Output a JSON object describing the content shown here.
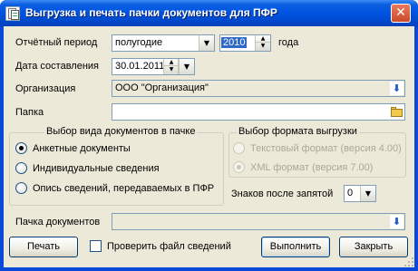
{
  "window": {
    "title": "Выгрузка и печать пачки документов для ПФР",
    "close_glyph": "✕"
  },
  "form": {
    "period_label": "Отчётный период",
    "period_value": "полугодие",
    "year_value": "2010",
    "year_suffix": "года",
    "date_label": "Дата составления",
    "date_value": "30.01.2011",
    "org_label": "Организация",
    "org_value": "ООО \"Организация\"",
    "folder_label": "Папка",
    "folder_value": "",
    "decimals_label": "Знаков после запятой",
    "decimals_value": "0",
    "pack_label": "Пачка документов",
    "pack_value": ""
  },
  "doc_type_group": {
    "title": "Выбор вида документов в пачке",
    "options": [
      {
        "label": "Анкетные документы",
        "selected": true
      },
      {
        "label": "Индивидуальные сведения",
        "selected": false
      },
      {
        "label": "Опись сведений, передаваемых в ПФР",
        "selected": false
      }
    ]
  },
  "format_group": {
    "title": "Выбор формата выгрузки",
    "options": [
      {
        "label": "Текстовый формат (версия 4.00)",
        "selected": false,
        "enabled": false
      },
      {
        "label": "XML формат (версия 7.00)",
        "selected": true,
        "enabled": false
      }
    ]
  },
  "footer": {
    "print_button": "Печать",
    "check_file_label": "Проверить файл сведений",
    "check_file_checked": false,
    "execute_button": "Выполнить",
    "close_button": "Закрыть"
  },
  "icons": {
    "dropdown": "▼",
    "spin_up": "▲",
    "spin_down": "▼",
    "lookup": "⬇"
  }
}
